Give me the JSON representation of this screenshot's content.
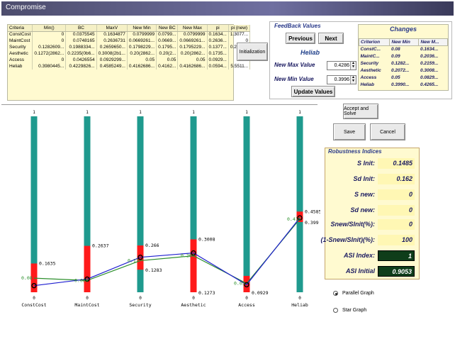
{
  "window": {
    "title": "Compromise"
  },
  "criteria_table": {
    "headers": [
      "Criteria",
      "Min()",
      "BC",
      "MaxV",
      "New Min",
      "New BC",
      "New Max",
      "pi",
      "pi (new)"
    ],
    "rows": [
      [
        "ConstCost",
        "0",
        "0.0375545",
        "0.1634877",
        "0.0799999",
        "0.0799...",
        "0.0799999",
        "0.1634...",
        "1.3077..."
      ],
      [
        "MaintCost",
        "0",
        "0.0748165",
        "0.2636731",
        "0.0669261...",
        "0.0669...",
        "0.0669261...",
        "0.2636...",
        "0"
      ],
      [
        "Security",
        "0.1282609...",
        "0.1988334...",
        "0.2659650...",
        "0.1798229...",
        "0.1795...",
        "0.1795229...",
        "0.1377...",
        "0.2755..."
      ],
      [
        "Aesthetic",
        "0.1272(2862...",
        "0.2235(0b6...",
        "0.3008(2b1...",
        "0.20(2862...",
        "0.20(2...",
        "0.20(2862...",
        "0.1735...",
        "0"
      ],
      [
        "Access",
        "0",
        "0.0426554",
        "0.0929299...",
        "0.05",
        "0.05",
        "0.05",
        "0.0929...",
        "0"
      ],
      [
        "Heliab",
        "0.3980445...",
        "0.4229826...",
        "0.4585249...",
        "0.4162686...",
        "0.4162...",
        "0.4162686...",
        "0.0594...",
        "5.5511..."
      ]
    ]
  },
  "buttons": {
    "initialization": "Initialization",
    "previous": "Previous",
    "next": "Next",
    "update_values": "Update Values",
    "accept_and_solve": "Accept and Solve",
    "save": "Save",
    "cancel": "Cancel"
  },
  "feedback": {
    "title": "FeedBack Values",
    "criterion": "Heliab",
    "max_label": "New Max Value",
    "max_value": "0.4286",
    "min_label": "New Min Value",
    "min_value": "0.3996"
  },
  "changes": {
    "title": "Changes",
    "headers": [
      "Criterion",
      "New Min",
      "New M..."
    ],
    "rows": [
      [
        "ConstC...",
        "0.08",
        "0.1634..."
      ],
      [
        "MaintC...",
        "0.09",
        "0.2036..."
      ],
      [
        "Security",
        "0.1282...",
        "0.2159..."
      ],
      [
        "Aesthetic",
        "0.2072...",
        "0.3008..."
      ],
      [
        "Access",
        "0.05",
        "0.0829..."
      ],
      [
        "Heliab",
        "0.3990...",
        "0.4265..."
      ]
    ]
  },
  "robustness": {
    "title": "Robustness Indices",
    "rows": [
      {
        "label": "S Init:",
        "value": "0.1485"
      },
      {
        "label": "Sd Init:",
        "value": "0.162"
      },
      {
        "label": "S new:",
        "value": "0"
      },
      {
        "label": "Sd new:",
        "value": "0"
      },
      {
        "label": "Snew/SInit(%):",
        "value": "0"
      },
      {
        "label": "(1-Snew/SInit)(%):",
        "value": "100"
      },
      {
        "label": "ASI Index:",
        "value": "1"
      },
      {
        "label": "ASI Initial",
        "value": "0.9053"
      }
    ]
  },
  "graph_mode": {
    "options": [
      "Parallel Graph",
      "Star Graph"
    ],
    "selected": "Parallel Graph"
  },
  "chart_data": {
    "type": "line",
    "categories": [
      "ConstCost",
      "MaintCost",
      "Security",
      "Aesthetic",
      "Access",
      "Heliab"
    ],
    "axis_top_label": "1",
    "axis_bottom_label": "0",
    "ylim": [
      0,
      1
    ],
    "ranges": [
      {
        "min": 0,
        "max": 0.1635
      },
      {
        "min": 0,
        "max": 0.2637
      },
      {
        "min": 0.1283,
        "max": 0.266
      },
      {
        "min": 0,
        "max": 0.3008
      },
      {
        "min": 0,
        "max": 0.0929
      },
      {
        "min": 0.399,
        "max": 0.4585
      }
    ],
    "range_labels": [
      {
        "high": "0.1635",
        "low": ""
      },
      {
        "high": "0.2637",
        "low": ""
      },
      {
        "high": "0.266",
        "low": "0.1283"
      },
      {
        "high": "0.3008",
        "low": "0.1273"
      },
      {
        "high": "",
        "low": "0.0929"
      },
      {
        "high": "0.4585",
        "low": "0.399"
      }
    ],
    "series": [
      {
        "values": [
          0.08,
          0.0669,
          0.1798,
          0.2073,
          0.05,
          0.4163
        ],
        "color": "#2d8f2d"
      },
      {
        "values": [
          0.0376,
          0.0748,
          0.1988,
          0.2235,
          0.0427,
          0.423
        ],
        "color": "#1f1fd0"
      }
    ],
    "point_labels": [
      "0.08",
      "0.066",
      "0.17",
      "0.207",
      "0.05",
      "0.416"
    ],
    "colors": {
      "axis": "#1f9a8e",
      "range": "#ff1a1a",
      "marker": "#000000"
    }
  }
}
